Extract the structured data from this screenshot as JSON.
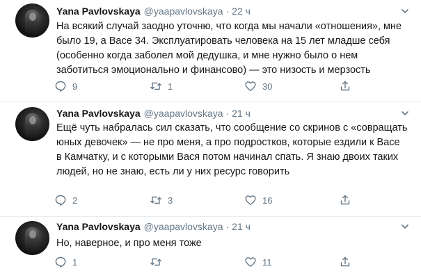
{
  "tweets": [
    {
      "author_name": "Yana Pavlovskaya",
      "handle": "@yaapavlovskaya",
      "separator": "·",
      "time": "22 ч",
      "text": "На всякий случай заодно уточню, что когда мы начали «отношения», мне было 19, а Васе 34. Эксплуатировать человека на 15 лет младше себя (особенно когда заболел мой дедушка, и мне нужно было о нем заботиться эмоционально и финансово) — это низость и мерзость",
      "replies": "9",
      "retweets": "1",
      "likes": "30"
    },
    {
      "author_name": "Yana Pavlovskaya",
      "handle": "@yaapavlovskaya",
      "separator": "·",
      "time": "21 ч",
      "text": "Ещё чуть набралась сил сказать, что сообщение со скринов с «совращать юных девочек» — не про меня, а про подростков, которые ездили к Васе в Камчатку, и с которыми Вася потом начинал спать. Я знаю двоих таких людей, но не знаю, есть ли у них ресурс говорить",
      "replies": "2",
      "retweets": "3",
      "likes": "16"
    },
    {
      "author_name": "Yana Pavlovskaya",
      "handle": "@yaapavlovskaya",
      "separator": "·",
      "time": "21 ч",
      "text": "Но, наверное, и про меня тоже",
      "replies": "1",
      "retweets": "",
      "likes": "11"
    }
  ],
  "icons": {
    "reply": "reply-icon",
    "retweet": "retweet-icon",
    "like": "heart-icon",
    "share": "share-icon",
    "more": "chevron-down-icon",
    "avatar": "avatar"
  },
  "colors": {
    "text": "#14171a",
    "secondary": "#657786",
    "divider": "#e6ecf0"
  }
}
